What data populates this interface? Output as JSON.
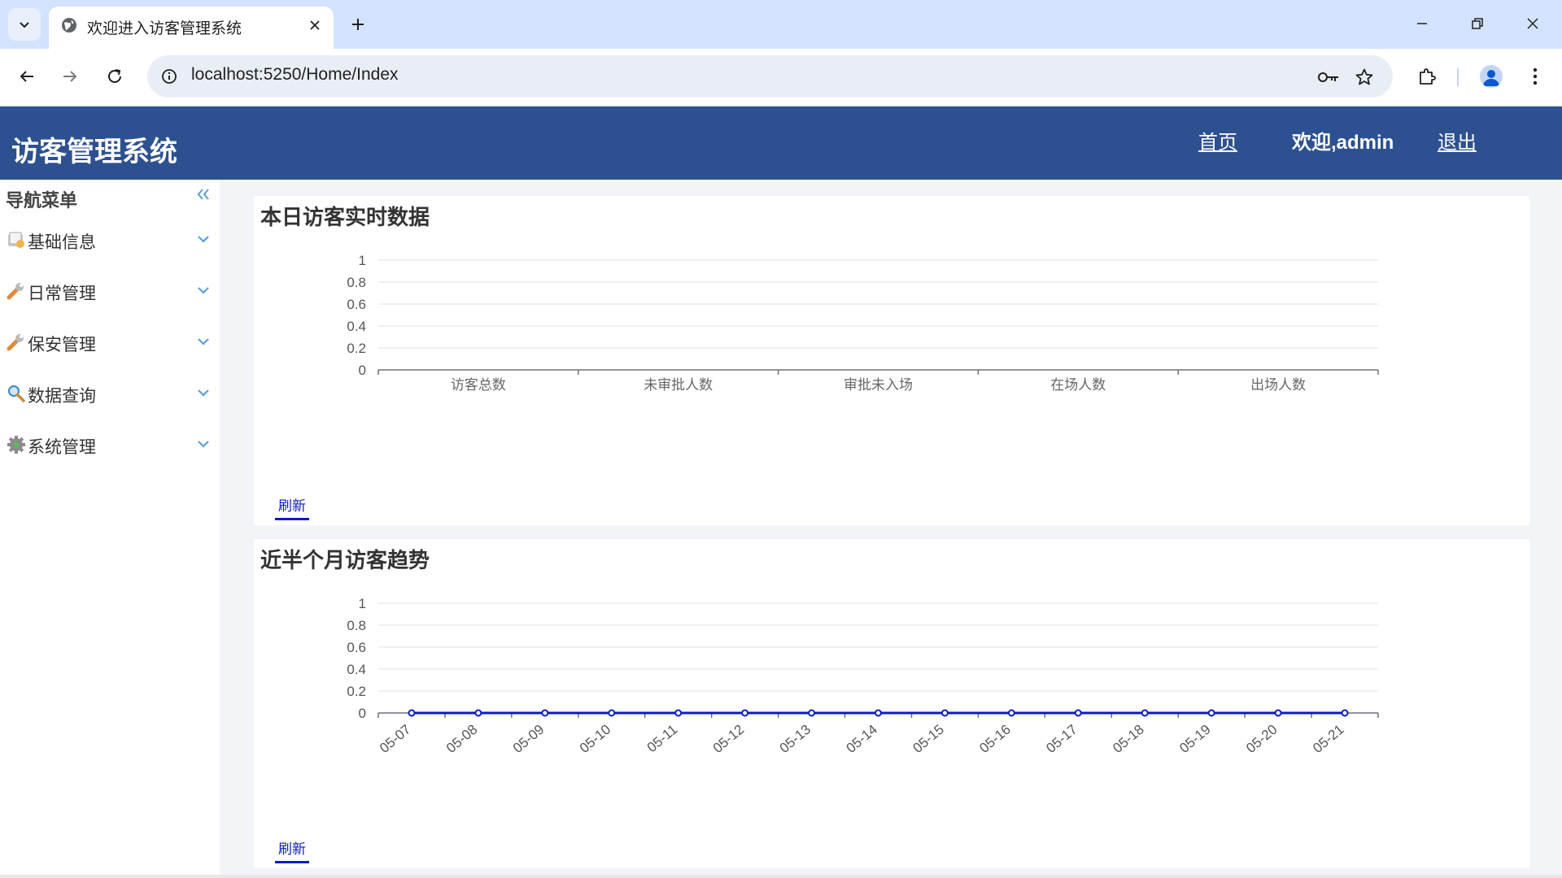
{
  "browser": {
    "tab_title": "欢迎进入访客管理系统",
    "url": "localhost:5250/Home/Index"
  },
  "header": {
    "app_title": "访客管理系统",
    "home_link": "首页",
    "welcome": "欢迎,admin",
    "logout_link": "退出"
  },
  "sidebar": {
    "title": "导航菜单",
    "items": [
      {
        "label": "基础信息",
        "icon": "folder-icon"
      },
      {
        "label": "日常管理",
        "icon": "wrench-icon"
      },
      {
        "label": "保安管理",
        "icon": "wrench-icon"
      },
      {
        "label": "数据查询",
        "icon": "magnifier-icon"
      },
      {
        "label": "系统管理",
        "icon": "gear-icon"
      }
    ]
  },
  "panels": [
    {
      "title": "本日访客实时数据",
      "refresh_label": "刷新"
    },
    {
      "title": "近半个月访客趋势",
      "refresh_label": "刷新"
    }
  ],
  "colors": {
    "header_bg": "#2d5190",
    "series_line": "#0b1bc4",
    "grid": "#e0e0e0"
  },
  "chart_data": [
    {
      "type": "bar",
      "title": "本日访客实时数据",
      "categories": [
        "访客总数",
        "未审批人数",
        "审批未入场",
        "在场人数",
        "出场人数"
      ],
      "values": [
        0,
        0,
        0,
        0,
        0
      ],
      "ylim": [
        0,
        1
      ],
      "yticks": [
        "1",
        "0.8",
        "0.6",
        "0.4",
        "0.2",
        "0"
      ],
      "grid": true
    },
    {
      "type": "line",
      "title": "近半个月访客趋势",
      "categories": [
        "05-07",
        "05-08",
        "05-09",
        "05-10",
        "05-11",
        "05-12",
        "05-13",
        "05-14",
        "05-15",
        "05-16",
        "05-17",
        "05-18",
        "05-19",
        "05-20",
        "05-21"
      ],
      "values": [
        0,
        0,
        0,
        0,
        0,
        0,
        0,
        0,
        0,
        0,
        0,
        0,
        0,
        0,
        0
      ],
      "ylim": [
        0,
        1
      ],
      "yticks": [
        "1",
        "0.8",
        "0.6",
        "0.4",
        "0.2",
        "0"
      ],
      "grid": true
    }
  ]
}
